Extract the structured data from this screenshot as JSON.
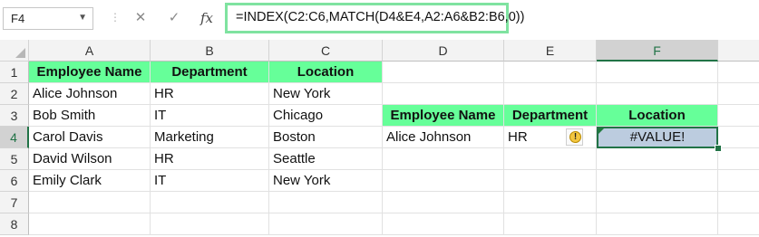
{
  "name_box": {
    "value": "F4"
  },
  "formula_bar": {
    "cancel_icon": "close-icon",
    "enter_icon": "checkmark-icon",
    "function_icon": "fx-icon",
    "function_label": "fx",
    "formula": "=INDEX(C2:C6,MATCH(D4&E4,A2:A6&B2:B6,0))"
  },
  "columns": [
    "A",
    "B",
    "C",
    "D",
    "E",
    "F"
  ],
  "selected_column": "F",
  "rows": [
    "1",
    "2",
    "3",
    "4",
    "5",
    "6",
    "7",
    "8"
  ],
  "selected_row": "4",
  "table": {
    "headers": [
      "Employee Name",
      "Department",
      "Location"
    ],
    "rows": [
      [
        "Alice Johnson",
        "HR",
        "New York"
      ],
      [
        "Bob Smith",
        "IT",
        "Chicago"
      ],
      [
        "Carol Davis",
        "Marketing",
        "Boston"
      ],
      [
        "David Wilson",
        "HR",
        "Seattle"
      ],
      [
        "Emily Clark",
        "IT",
        "New York"
      ]
    ]
  },
  "lookup": {
    "headers": [
      "Employee Name",
      "Department",
      "Location"
    ],
    "name": "Alice Johnson",
    "department": "HR",
    "result": "#VALUE!"
  },
  "error_indicator_icon": "warning-icon",
  "error_indicator_glyph": "!",
  "colors": {
    "header_fill": "#66ff99",
    "active_cell_fill": "#bcccdf",
    "selection_border": "#217346",
    "formula_highlight": "#7fe3a0"
  }
}
